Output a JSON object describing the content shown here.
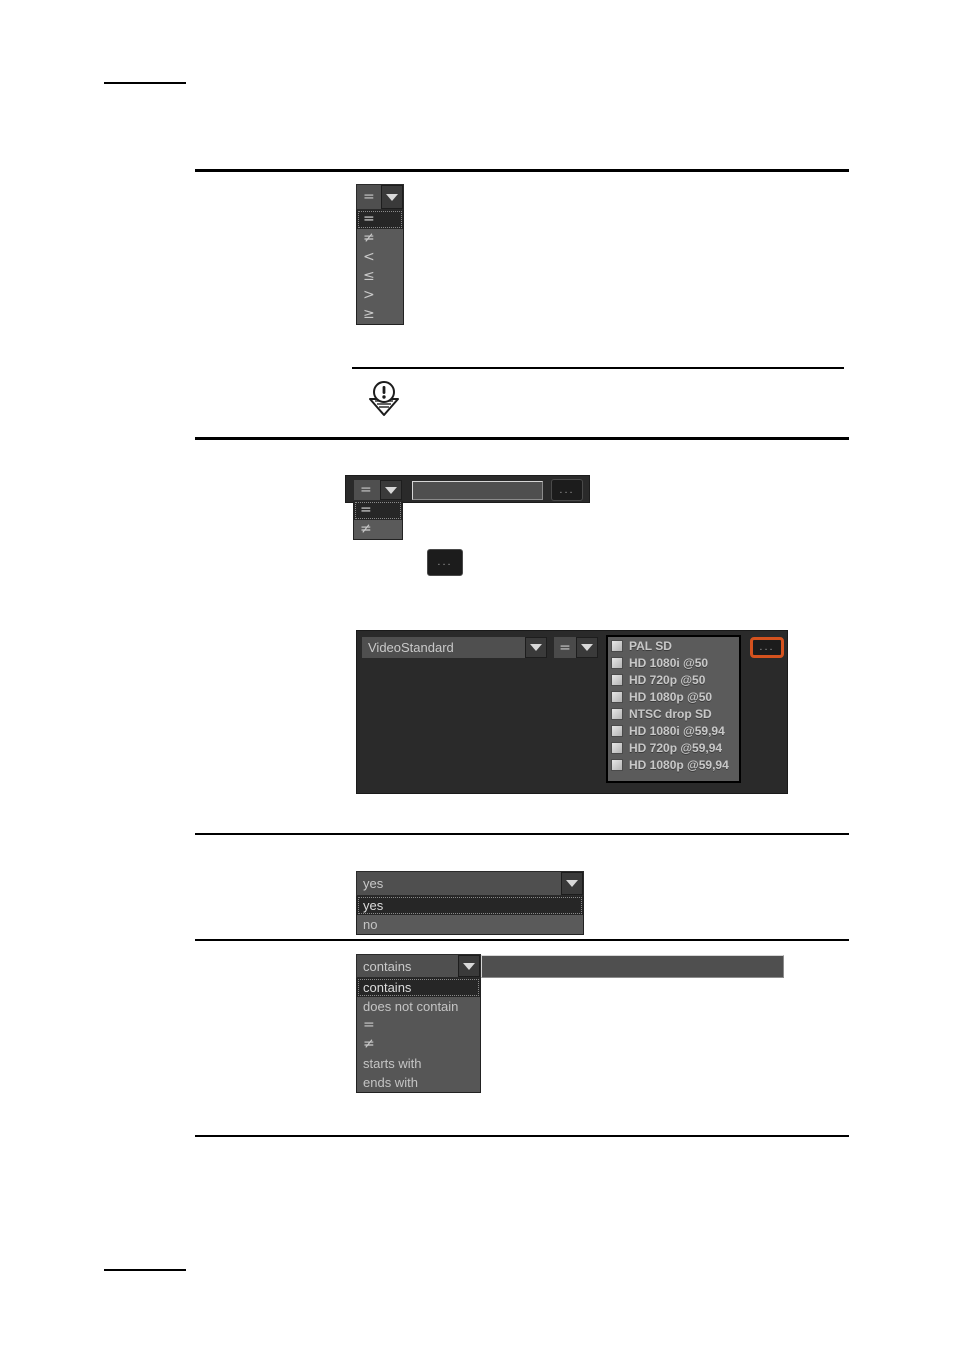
{
  "page": {
    "title": "Filter condition editor widgets",
    "background": "#ffffff"
  },
  "colors": {
    "widget_face": "#4f4f4f",
    "widget_dark": "#2a2a2a",
    "list_face": "#5b5b5b",
    "text": "#c8c8c8",
    "focus_orange": "#d4521e",
    "selected_row": "#262626"
  },
  "numeric_operator_combo": {
    "name": "numeric-operator-combo",
    "selected_value": "=",
    "arrow_icon": "chevron-down-icon",
    "options": [
      {
        "label": "=",
        "selected": true
      },
      {
        "label": "≠",
        "selected": false
      },
      {
        "label": "<",
        "selected": false
      },
      {
        "label": "≤",
        "selected": false
      },
      {
        "label": ">",
        "selected": false
      },
      {
        "label": "≥",
        "selected": false
      }
    ]
  },
  "note_block": {
    "icon": "note-warning-icon",
    "text": ""
  },
  "equality_operator_row": {
    "name": "equality-operator-row",
    "combo": {
      "selected_value": "=",
      "arrow_icon": "chevron-down-icon",
      "options": [
        {
          "label": "=",
          "selected": true
        },
        {
          "label": "≠",
          "selected": false
        }
      ]
    },
    "value_field": {
      "value": "",
      "placeholder": ""
    },
    "browse_button_label": "..."
  },
  "standalone_browse_button": {
    "name": "browse-button",
    "label": "..."
  },
  "video_standard_panel": {
    "name": "video-standard-panel",
    "field_combo": {
      "selected_value": "VideoStandard",
      "arrow_icon": "chevron-down-icon"
    },
    "operator_combo": {
      "selected_value": "=",
      "arrow_icon": "chevron-down-icon"
    },
    "browse_button_label": "...",
    "browse_button_focused": true,
    "checklist": [
      {
        "label": "PAL SD",
        "checked": false
      },
      {
        "label": "HD 1080i @50",
        "checked": false
      },
      {
        "label": "HD 720p @50",
        "checked": false
      },
      {
        "label": "HD 1080p @50",
        "checked": false
      },
      {
        "label": "NTSC drop SD",
        "checked": false
      },
      {
        "label": "HD 1080i @59,94",
        "checked": false
      },
      {
        "label": "HD 720p @59,94",
        "checked": false
      },
      {
        "label": "HD 1080p @59,94",
        "checked": false
      }
    ]
  },
  "boolean_combo": {
    "name": "boolean-combo",
    "selected_value": "yes",
    "arrow_icon": "chevron-down-icon",
    "options": [
      {
        "label": "yes",
        "selected": true
      },
      {
        "label": "no",
        "selected": false
      }
    ]
  },
  "string_operator_combo": {
    "name": "string-operator-combo",
    "selected_value": "contains",
    "arrow_icon": "chevron-down-icon",
    "options": [
      {
        "label": "contains",
        "selected": true
      },
      {
        "label": "does not contain",
        "selected": false
      },
      {
        "label": "=",
        "selected": false
      },
      {
        "label": "≠",
        "selected": false
      },
      {
        "label": "starts with",
        "selected": false
      },
      {
        "label": "ends with",
        "selected": false
      }
    ],
    "value_field": {
      "value": "",
      "placeholder": ""
    }
  }
}
